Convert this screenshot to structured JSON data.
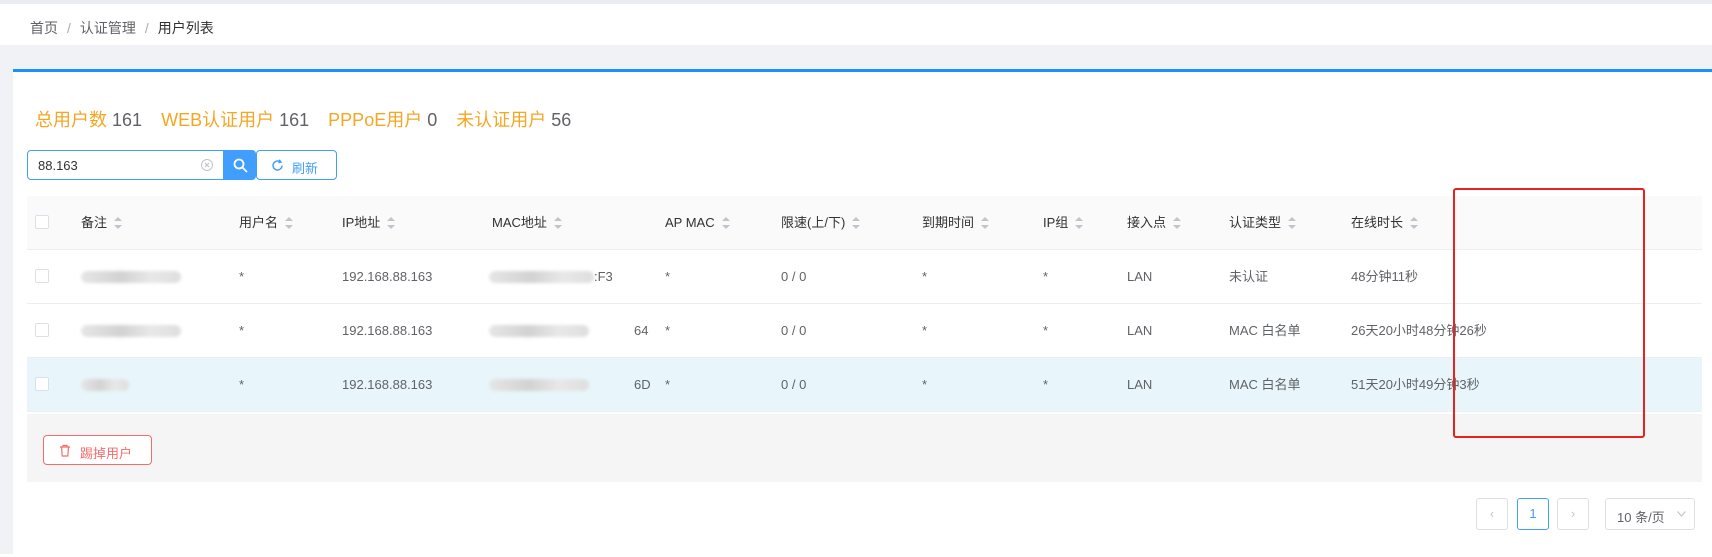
{
  "breadcrumb": {
    "items": [
      "首页",
      "认证管理",
      "用户列表"
    ],
    "separator": "/"
  },
  "stats": {
    "total_label": "总用户数",
    "total_value": "161",
    "web_label": "WEB认证用户",
    "web_value": "161",
    "pppoe_label": "PPPoE用户",
    "pppoe_value": "0",
    "unauth_label": "未认证用户",
    "unauth_value": "56"
  },
  "search": {
    "value": "88.163",
    "refresh_label": "刷新"
  },
  "table": {
    "columns": [
      "备注",
      "用户名",
      "IP地址",
      "MAC地址",
      "AP MAC",
      "限速(上/下)",
      "到期时间",
      "IP组",
      "接入点",
      "认证类型",
      "在线时长"
    ],
    "rows": [
      {
        "username": "*",
        "ip": "192.168.88.163",
        "mac_suffix": ":F3",
        "ap_mac": "*",
        "rate": "0 / 0",
        "expire": "*",
        "ip_group": "*",
        "access_point": "LAN",
        "auth_type": "未认证",
        "online": "48分钟11秒"
      },
      {
        "username": "*",
        "ip": "192.168.88.163",
        "mac_suffix": "64",
        "ap_mac": "*",
        "rate": "0 / 0",
        "expire": "*",
        "ip_group": "*",
        "access_point": "LAN",
        "auth_type": "MAC 白名单",
        "online": "26天20小时48分钟26秒"
      },
      {
        "username": "*",
        "ip": "192.168.88.163",
        "mac_suffix": "6D",
        "ap_mac": "*",
        "rate": "0 / 0",
        "expire": "*",
        "ip_group": "*",
        "access_point": "LAN",
        "auth_type": "MAC 白名单",
        "online": "51天20小时49分钟3秒"
      }
    ]
  },
  "actions": {
    "kick_label": "踢掉用户"
  },
  "pagination": {
    "current_page": "1",
    "page_size_label": "10 条/页"
  },
  "colors": {
    "primary": "#409eff",
    "stat_label": "#f5a623",
    "danger": "#f56c6c",
    "annotation": "#e8221f"
  }
}
